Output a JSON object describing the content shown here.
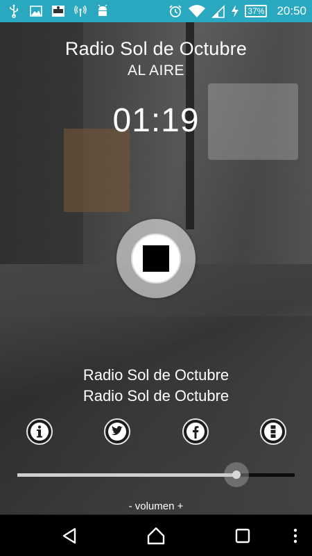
{
  "status_bar": {
    "left_icons": [
      "usb-icon",
      "image-icon",
      "app-logo-icon",
      "wireless-icon",
      "android-debug-icon"
    ],
    "right_icons": [
      "alarm-icon",
      "wifi-icon",
      "signal-icon",
      "charging-icon"
    ],
    "battery": "37%",
    "time": "20:50",
    "color": "#29a8c0"
  },
  "header": {
    "title": "Radio Sol de Octubre",
    "status": "AL AIRE",
    "elapsed": "01:19"
  },
  "player": {
    "control_icon": "stop-icon"
  },
  "track": {
    "line1": "Radio Sol de Octubre",
    "line2": "Radio Sol de Octubre"
  },
  "social": [
    {
      "name": "info",
      "icon": "info-icon"
    },
    {
      "name": "twitter",
      "icon": "twitter-icon"
    },
    {
      "name": "facebook",
      "icon": "facebook-icon"
    },
    {
      "name": "more",
      "icon": "more-vertical-icon"
    }
  ],
  "volume": {
    "label": "- volumen +",
    "level": 0.79
  },
  "nav": {
    "icons": [
      "back-icon",
      "home-icon",
      "recents-icon",
      "overflow-menu-icon"
    ]
  }
}
